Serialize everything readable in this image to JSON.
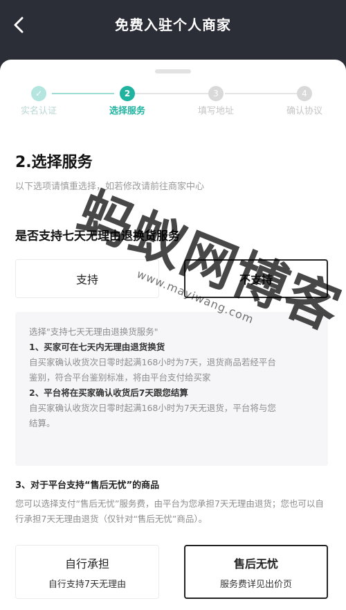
{
  "header": {
    "title": "免费入驻个人商家"
  },
  "stepper": {
    "steps": [
      {
        "label": "实名认证",
        "number": "✓",
        "state": "done"
      },
      {
        "label": "选择服务",
        "number": "2",
        "state": "active"
      },
      {
        "label": "填写地址",
        "number": "3",
        "state": "todo"
      },
      {
        "label": "确认协议",
        "number": "4",
        "state": "todo"
      }
    ]
  },
  "section": {
    "title": "2.选择服务",
    "hint": "以下选项请慎重选择，如若修改请前往商家中心"
  },
  "question": {
    "title": "是否支持七天无理由退换货服务",
    "options": [
      {
        "label": "支持",
        "selected": false
      },
      {
        "label": "不支持",
        "selected": true
      }
    ]
  },
  "info": {
    "lines": [
      {
        "text": "选择\"支持七天无理由退换货服务\"",
        "strong": false
      },
      {
        "text": "1、买家可在七天内无理由退货换货",
        "strong": true
      },
      {
        "text": "自买家确认收货次日零时起满168小时为7天，退货商品若经平台",
        "strong": false
      },
      {
        "text": "鉴别，符合平台鉴别标准，将由平台支付给买家",
        "strong": false
      },
      {
        "text": "2、平台将在买家确认收货后7天跟您结算",
        "strong": true
      },
      {
        "text": "自买家确认收货次日零时起满168小时为7天无退货，平台将与您",
        "strong": false
      },
      {
        "text": "结算。",
        "strong": false
      }
    ]
  },
  "rule3": {
    "heading": "3、对于平台支持“售后无忧”的商品",
    "body": "您可以选择支付“售后无忧”服务费，由平台为您承担7天无理由退货；您也可以自行承担7天无理由退货（仅针对“售后无忧”商品）。"
  },
  "after_sale": {
    "options": [
      {
        "title": "自行承担",
        "subtitle": "自行支持7天无理由",
        "selected": false
      },
      {
        "title": "售后无忧",
        "subtitle": "服务费详见出价页",
        "selected": true
      }
    ]
  },
  "watermark": {
    "text": "蚂蚁网博客",
    "sub": "www.mayiwang.com"
  },
  "colors": {
    "accent": "#1fb3a0",
    "header_bg": "#2b2d37"
  }
}
